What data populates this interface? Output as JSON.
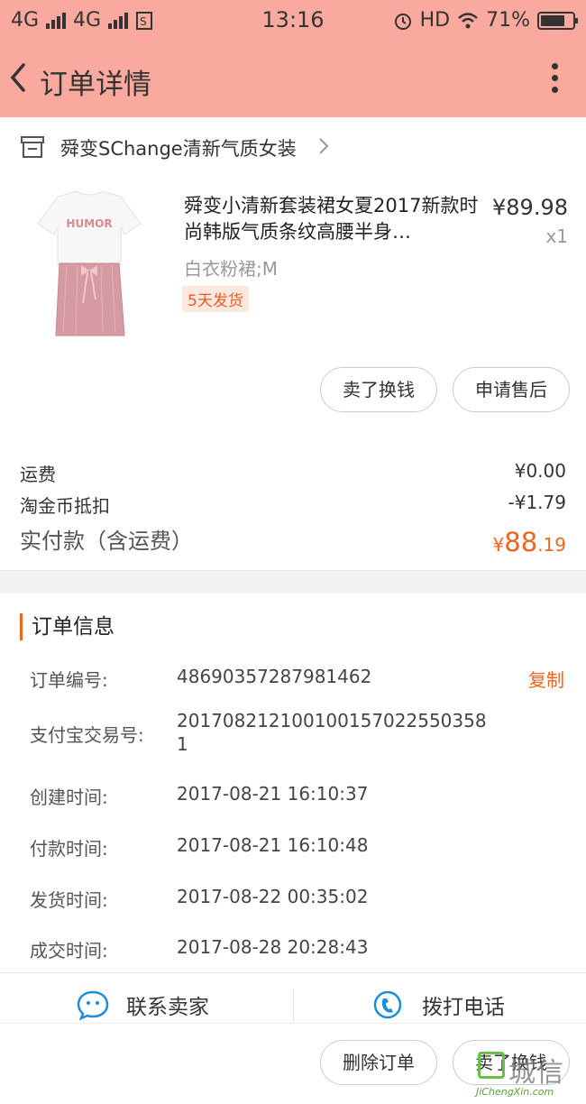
{
  "status_bar": {
    "net1": "4G",
    "net2": "4G",
    "time": "13:16",
    "hd": "HD",
    "battery": "71%"
  },
  "header": {
    "title": "订单详情"
  },
  "shop": {
    "name": "舜变SChange清新气质女装"
  },
  "product": {
    "title": "舜变小清新套装裙女夏2017新款时尚韩版气质条纹高腰半身…",
    "price": "¥89.98",
    "qty": "x1",
    "sku": "白衣粉裙;M",
    "ship_badge": "5天发货",
    "image_text": "HUMOR"
  },
  "actions": {
    "sell": "卖了换钱",
    "aftersale": "申请售后"
  },
  "fees": {
    "shipping_label": "运费",
    "shipping_value": "¥0.00",
    "coin_label": "淘金币抵扣",
    "coin_value": "-¥1.79",
    "total_label": "实付款（含运费）",
    "total_currency": "¥",
    "total_int": "88",
    "total_dec": ".19"
  },
  "order_info": {
    "title": "订单信息",
    "copy": "复制",
    "rows": [
      {
        "label": "订单编号:",
        "value": "48690357287981462"
      },
      {
        "label": "支付宝交易号:",
        "value": "2017082121001001570225503581"
      },
      {
        "label": "创建时间:",
        "value": "2017-08-21 16:10:37"
      },
      {
        "label": "付款时间:",
        "value": "2017-08-21 16:10:48"
      },
      {
        "label": "发货时间:",
        "value": "2017-08-22 00:35:02"
      },
      {
        "label": "成交时间:",
        "value": "2017-08-28 20:28:43"
      }
    ]
  },
  "contact": {
    "seller": "联系卖家",
    "call": "拨打电话"
  },
  "footer": {
    "delete": "删除订单",
    "sell": "卖了换钱"
  },
  "watermark": {
    "text": "城信",
    "url": "JiChengXin.com"
  },
  "colors": {
    "header_bg": "#f9a99d",
    "accent": "#f0641e"
  }
}
